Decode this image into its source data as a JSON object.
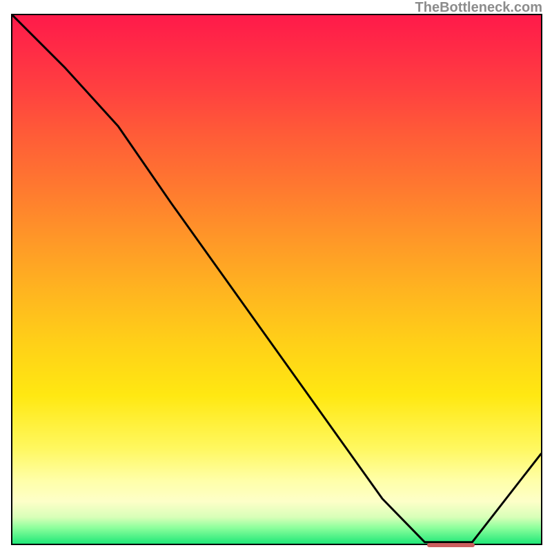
{
  "watermark": "TheBottleneck.com",
  "colors": {
    "line": "#000000",
    "border": "#000000",
    "marker": "#cc5e5e"
  },
  "chart_data": {
    "type": "line",
    "title": "",
    "xlabel": "",
    "ylabel": "",
    "xlim": [
      0,
      100
    ],
    "ylim": [
      0,
      100
    ],
    "grid": false,
    "note": "Axes are unlabeled in the image; x/y normalized 0–100. The curve starts high at the left, descends steeply, reaches a flat minimum near x≈78–87 (highlighted by a red marker at the baseline), then rises toward the right edge.",
    "series": [
      {
        "name": "curve",
        "x": [
          0,
          10,
          20,
          30,
          40,
          50,
          60,
          70,
          78,
          87,
          100
        ],
        "values": [
          100,
          90,
          79,
          64.5,
          50.5,
          36.5,
          22.5,
          8.5,
          0.3,
          0.3,
          17
        ]
      }
    ],
    "flat_region": {
      "x_start": 78,
      "x_end": 87,
      "y": 0.3
    }
  }
}
